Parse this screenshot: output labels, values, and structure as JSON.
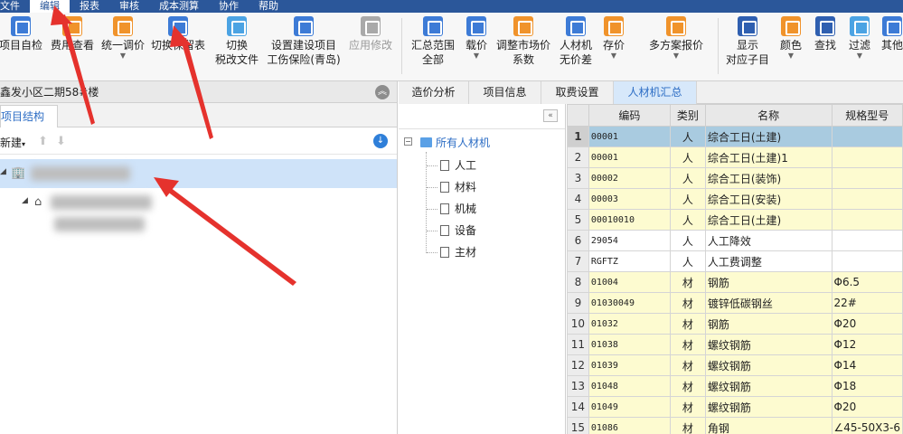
{
  "menu": [
    "文件",
    "编辑",
    "报表",
    "审核",
    "成本测算",
    "协作",
    "帮助"
  ],
  "ribbon": {
    "b1": "项目自检",
    "b2": "费用查看",
    "b3": "统一调价",
    "b4": "切换保留表",
    "b5_l1": "切换",
    "b5_l2": "税改文件",
    "b6_l1": "设置建设项目",
    "b6_l2": "工伤保险(青岛)",
    "b7": "应用修改",
    "b8_l1": "汇总范围",
    "b8_l2": "全部",
    "b9": "载价",
    "b10_l1": "调整市场价",
    "b10_l2": "系数",
    "b11_l1": "人材机",
    "b11_l2": "无价差",
    "b12": "存价",
    "b13": "多方案报价",
    "b14_l1": "显示",
    "b14_l2": "对应子目",
    "b15": "颜色",
    "b16": "查找",
    "b17": "过滤",
    "b18": "其他"
  },
  "left": {
    "title": "鑫发小区二期58#楼",
    "tab": "项目结构",
    "new": "新建"
  },
  "tabs": [
    "造价分析",
    "项目信息",
    "取费设置",
    "人材机汇总"
  ],
  "mtree": {
    "root": "所有人材机",
    "items": [
      "人工",
      "材料",
      "机械",
      "设备",
      "主材"
    ]
  },
  "grid": {
    "headers": [
      "编码",
      "类别",
      "名称",
      "规格型号"
    ],
    "rows": [
      {
        "n": "1",
        "code": "00001",
        "cat": "人",
        "name": "综合工日(土建)",
        "spec": ""
      },
      {
        "n": "2",
        "code": "00001",
        "cat": "人",
        "name": "综合工日(土建)1",
        "spec": ""
      },
      {
        "n": "3",
        "code": "00002",
        "cat": "人",
        "name": "综合工日(装饰)",
        "spec": ""
      },
      {
        "n": "4",
        "code": "00003",
        "cat": "人",
        "name": "综合工日(安装)",
        "spec": ""
      },
      {
        "n": "5",
        "code": "00010010",
        "cat": "人",
        "name": "综合工日(土建)",
        "spec": ""
      },
      {
        "n": "6",
        "code": "29054",
        "cat": "人",
        "name": "人工降效",
        "spec": ""
      },
      {
        "n": "7",
        "code": "RGFTZ",
        "cat": "人",
        "name": "人工费调整",
        "spec": ""
      },
      {
        "n": "8",
        "code": "01004",
        "cat": "材",
        "name": "钢筋",
        "spec": "Φ6.5"
      },
      {
        "n": "9",
        "code": "01030049",
        "cat": "材",
        "name": "镀锌低碳钢丝",
        "spec": "22#"
      },
      {
        "n": "10",
        "code": "01032",
        "cat": "材",
        "name": "钢筋",
        "spec": "Φ20"
      },
      {
        "n": "11",
        "code": "01038",
        "cat": "材",
        "name": "螺纹钢筋",
        "spec": "Φ12"
      },
      {
        "n": "12",
        "code": "01039",
        "cat": "材",
        "name": "螺纹钢筋",
        "spec": "Φ14"
      },
      {
        "n": "13",
        "code": "01048",
        "cat": "材",
        "name": "螺纹钢筋",
        "spec": "Φ18"
      },
      {
        "n": "14",
        "code": "01049",
        "cat": "材",
        "name": "螺纹钢筋",
        "spec": "Φ20"
      },
      {
        "n": "15",
        "code": "01086",
        "cat": "材",
        "name": "角钢",
        "spec": "∠45-50X3-6"
      }
    ]
  },
  "colors": {
    "accent": "#2b579a",
    "selected_row": "#a9cbe0",
    "highlight_row": "#fdfbd0",
    "annotation": "#e5322d"
  }
}
